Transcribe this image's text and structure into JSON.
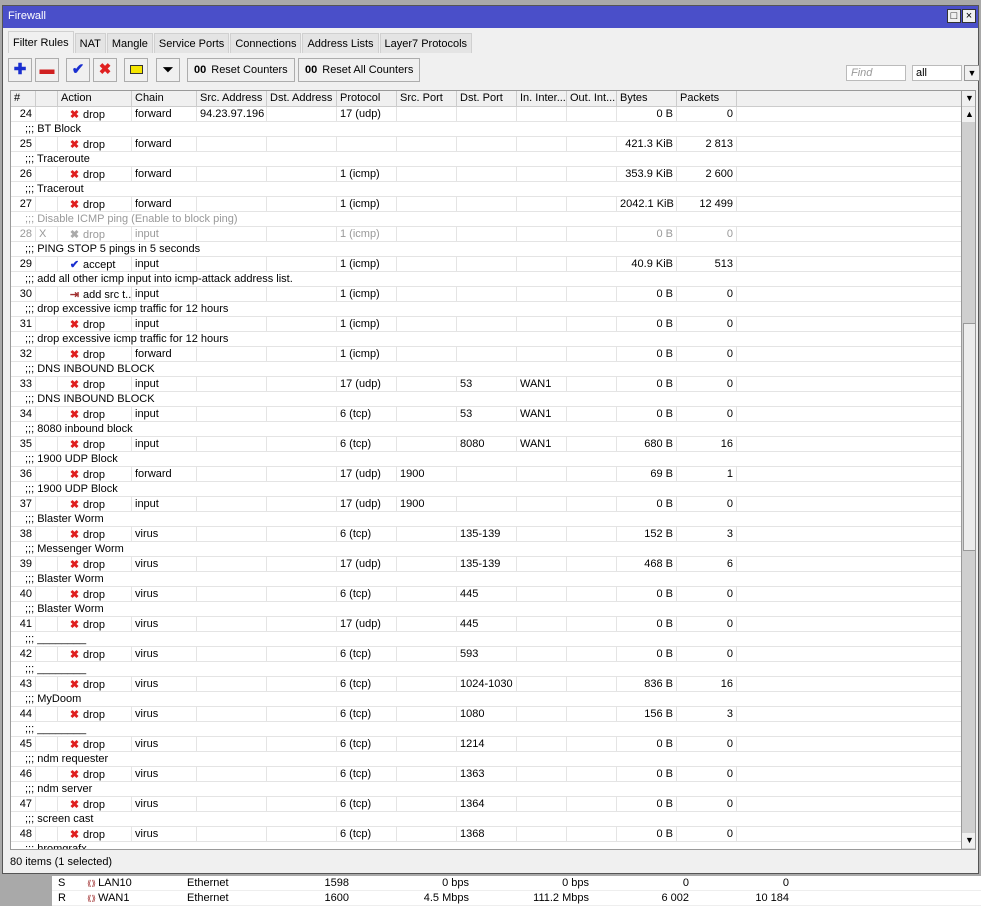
{
  "window": {
    "title": "Firewall",
    "maximize_icon": "maximize-icon",
    "close_icon": "close-icon"
  },
  "tabs": [
    "Filter Rules",
    "NAT",
    "Mangle",
    "Service Ports",
    "Connections",
    "Address Lists",
    "Layer7 Protocols"
  ],
  "toolbar": {
    "reset_counters": "Reset Counters",
    "reset_all_counters": "Reset All Counters",
    "counter_glyph": "00",
    "find_placeholder": "Find",
    "filter_value": "all"
  },
  "columns": [
    "#",
    "",
    "Action",
    "Chain",
    "Src. Address",
    "Dst. Address",
    "Protocol",
    "Src. Port",
    "Dst. Port",
    "In. Inter...",
    "Out. Int...",
    "Bytes",
    "Packets"
  ],
  "rows": [
    {
      "n": "24",
      "action": "drop",
      "chain": "forward",
      "src": "94.23.97.196",
      "proto": "17 (udp)",
      "bytes": "0 B",
      "packets": "0"
    },
    {
      "comment": ";;; BT Block"
    },
    {
      "n": "25",
      "action": "drop",
      "chain": "forward",
      "bytes": "421.3 KiB",
      "packets": "2 813"
    },
    {
      "comment": ";;; Traceroute"
    },
    {
      "n": "26",
      "action": "drop",
      "chain": "forward",
      "proto": "1 (icmp)",
      "bytes": "353.9 KiB",
      "packets": "2 600"
    },
    {
      "comment": ";;; Tracerout"
    },
    {
      "n": "27",
      "action": "drop",
      "chain": "forward",
      "proto": "1 (icmp)",
      "bytes": "2042.1 KiB",
      "packets": "12 499"
    },
    {
      "comment": ";;; Disable ICMP ping (Enable to block ping)",
      "disabled": true
    },
    {
      "n": "28",
      "flag": "X",
      "action": "drop",
      "chain": "input",
      "proto": "1 (icmp)",
      "bytes": "0 B",
      "packets": "0",
      "disabled": true
    },
    {
      "comment": ";;; PING STOP 5 pings in 5 seconds"
    },
    {
      "n": "29",
      "action": "accept",
      "chain": "input",
      "proto": "1 (icmp)",
      "bytes": "40.9 KiB",
      "packets": "513"
    },
    {
      "comment": ";;; add all other icmp input into icmp-attack address list."
    },
    {
      "n": "30",
      "action": "add src t...",
      "chain": "input",
      "proto": "1 (icmp)",
      "bytes": "0 B",
      "packets": "0"
    },
    {
      "comment": ";;; drop excessive icmp traffic for 12 hours"
    },
    {
      "n": "31",
      "action": "drop",
      "chain": "input",
      "proto": "1 (icmp)",
      "bytes": "0 B",
      "packets": "0"
    },
    {
      "comment": ";;; drop excessive icmp traffic for 12 hours"
    },
    {
      "n": "32",
      "action": "drop",
      "chain": "forward",
      "proto": "1 (icmp)",
      "bytes": "0 B",
      "packets": "0"
    },
    {
      "comment": ";;; DNS INBOUND BLOCK"
    },
    {
      "n": "33",
      "action": "drop",
      "chain": "input",
      "proto": "17 (udp)",
      "dport": "53",
      "inif": "WAN1",
      "bytes": "0 B",
      "packets": "0"
    },
    {
      "comment": ";;; DNS INBOUND BLOCK"
    },
    {
      "n": "34",
      "action": "drop",
      "chain": "input",
      "proto": "6 (tcp)",
      "dport": "53",
      "inif": "WAN1",
      "bytes": "0 B",
      "packets": "0"
    },
    {
      "comment": ";;; 8080 inbound block"
    },
    {
      "n": "35",
      "action": "drop",
      "chain": "input",
      "proto": "6 (tcp)",
      "dport": "8080",
      "inif": "WAN1",
      "bytes": "680 B",
      "packets": "16"
    },
    {
      "comment": ";;; 1900 UDP Block"
    },
    {
      "n": "36",
      "action": "drop",
      "chain": "forward",
      "proto": "17 (udp)",
      "sport": "1900",
      "bytes": "69 B",
      "packets": "1"
    },
    {
      "comment": ";;; 1900 UDP Block"
    },
    {
      "n": "37",
      "action": "drop",
      "chain": "input",
      "proto": "17 (udp)",
      "sport": "1900",
      "bytes": "0 B",
      "packets": "0"
    },
    {
      "comment": ";;; Blaster Worm"
    },
    {
      "n": "38",
      "action": "drop",
      "chain": "virus",
      "proto": "6 (tcp)",
      "dport": "135-139",
      "bytes": "152 B",
      "packets": "3"
    },
    {
      "comment": ";;; Messenger Worm"
    },
    {
      "n": "39",
      "action": "drop",
      "chain": "virus",
      "proto": "17 (udp)",
      "dport": "135-139",
      "bytes": "468 B",
      "packets": "6"
    },
    {
      "comment": ";;; Blaster Worm"
    },
    {
      "n": "40",
      "action": "drop",
      "chain": "virus",
      "proto": "6 (tcp)",
      "dport": "445",
      "bytes": "0 B",
      "packets": "0"
    },
    {
      "comment": ";;; Blaster Worm"
    },
    {
      "n": "41",
      "action": "drop",
      "chain": "virus",
      "proto": "17 (udp)",
      "dport": "445",
      "bytes": "0 B",
      "packets": "0"
    },
    {
      "comment": ";;; ________"
    },
    {
      "n": "42",
      "action": "drop",
      "chain": "virus",
      "proto": "6 (tcp)",
      "dport": "593",
      "bytes": "0 B",
      "packets": "0"
    },
    {
      "comment": ";;; ________"
    },
    {
      "n": "43",
      "action": "drop",
      "chain": "virus",
      "proto": "6 (tcp)",
      "dport": "1024-1030",
      "bytes": "836 B",
      "packets": "16"
    },
    {
      "comment": ";;; MyDoom"
    },
    {
      "n": "44",
      "action": "drop",
      "chain": "virus",
      "proto": "6 (tcp)",
      "dport": "1080",
      "bytes": "156 B",
      "packets": "3"
    },
    {
      "comment": ";;; ________"
    },
    {
      "n": "45",
      "action": "drop",
      "chain": "virus",
      "proto": "6 (tcp)",
      "dport": "1214",
      "bytes": "0 B",
      "packets": "0"
    },
    {
      "comment": ";;; ndm requester"
    },
    {
      "n": "46",
      "action": "drop",
      "chain": "virus",
      "proto": "6 (tcp)",
      "dport": "1363",
      "bytes": "0 B",
      "packets": "0"
    },
    {
      "comment": ";;; ndm server"
    },
    {
      "n": "47",
      "action": "drop",
      "chain": "virus",
      "proto": "6 (tcp)",
      "dport": "1364",
      "bytes": "0 B",
      "packets": "0"
    },
    {
      "comment": ";;; screen cast"
    },
    {
      "n": "48",
      "action": "drop",
      "chain": "virus",
      "proto": "6 (tcp)",
      "dport": "1368",
      "bytes": "0 B",
      "packets": "0"
    },
    {
      "comment": ";;; hromgrafx"
    }
  ],
  "status": "80 items (1 selected)",
  "background_rows": [
    {
      "flag": "S",
      "name": "LAN10",
      "type": "Ethernet",
      "mtu": "1598",
      "tx": "0 bps",
      "rx": "0 bps",
      "txp": "0",
      "rxp": "0"
    },
    {
      "flag": "R",
      "name": "WAN1",
      "type": "Ethernet",
      "mtu": "1600",
      "tx": "4.5 Mbps",
      "rx": "111.2 Mbps",
      "txp": "6 002",
      "rxp": "10 184"
    }
  ],
  "colors": {
    "titlebar": "#4a4fc9",
    "drop": "#e02020",
    "accept": "#1a2fd0"
  }
}
